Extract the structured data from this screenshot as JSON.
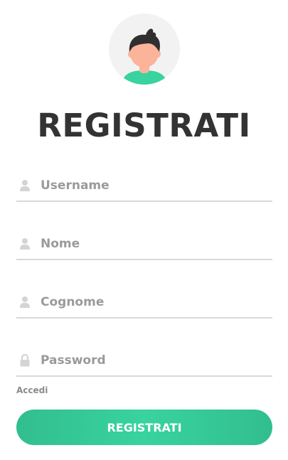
{
  "form": {
    "title": "REGISTRATI",
    "fields": [
      {
        "placeholder": "Username",
        "value": "",
        "icon": "user-icon"
      },
      {
        "placeholder": "Nome",
        "value": "",
        "icon": "user-icon"
      },
      {
        "placeholder": "Cognome",
        "value": "",
        "icon": "user-icon"
      },
      {
        "placeholder": "Password",
        "value": "",
        "icon": "lock-icon"
      }
    ],
    "login_link": "Accedi",
    "submit_label": "REGISTRATI"
  },
  "colors": {
    "accent": "#38d39f",
    "accent_dark": "#32be8f",
    "title": "#333333",
    "placeholder": "#999999",
    "underline": "#d9d9d9",
    "icon": "#d4d4d4"
  }
}
